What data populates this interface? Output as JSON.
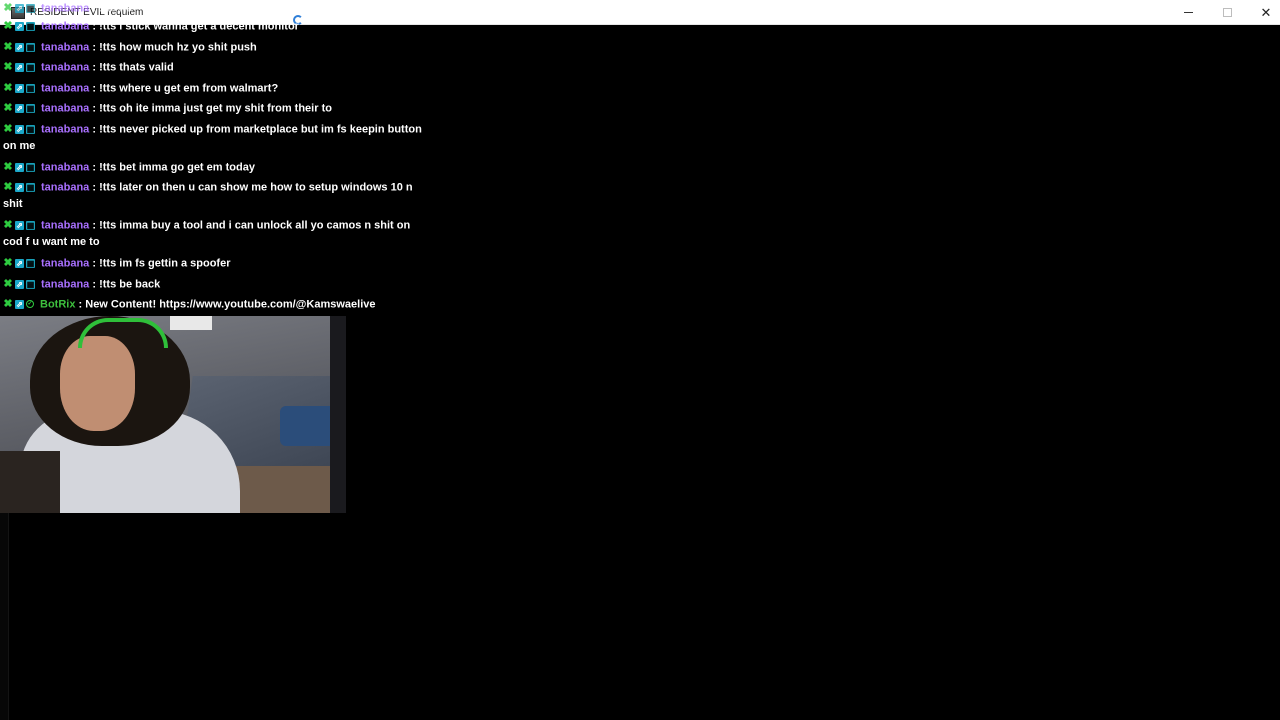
{
  "window": {
    "title": "RESIDENT EVIL requiem",
    "icon": "app-icon",
    "controls": {
      "minimize": "minimize-icon",
      "maximize": "maximize-icon",
      "close_glyph": "✕"
    }
  },
  "chat": {
    "colors": {
      "username": "#a970ff",
      "bot_username": "#3ec13e",
      "mod_badge": "#2ecc40",
      "vip_badge": "#1aa7c9"
    },
    "messages": [
      {
        "user": "tanabana",
        "sep": ":",
        "text": "!tts ite",
        "ghost": true
      },
      {
        "user": "tanabana",
        "sep": ":",
        "text": "!tts i stick wanna get a decent monitor"
      },
      {
        "user": "tanabana",
        "sep": ":",
        "text": "!tts how much hz yo shit push"
      },
      {
        "user": "tanabana",
        "sep": ":",
        "text": "!tts thats valid"
      },
      {
        "user": "tanabana",
        "sep": ":",
        "text": "!tts where u get em from walmart?"
      },
      {
        "user": "tanabana",
        "sep": ":",
        "text": "!tts oh ite imma just get my shit from their to"
      },
      {
        "user": "tanabana",
        "sep": ":",
        "text": "!tts never picked up from marketplace but im fs keepin button on me"
      },
      {
        "user": "tanabana",
        "sep": ":",
        "text": "!tts bet imma go get em today"
      },
      {
        "user": "tanabana",
        "sep": ":",
        "text": "!tts later on then u can show me how to setup windows 10 n shit"
      },
      {
        "user": "tanabana",
        "sep": ":",
        "text": "!tts imma buy a tool and i can unlock all yo camos n shit on cod f u want me to"
      },
      {
        "user": "tanabana",
        "sep": ":",
        "text": "!tts im fs gettin a spoofer"
      },
      {
        "user": "tanabana",
        "sep": ":",
        "text": "!tts be back"
      },
      {
        "user": "BotRix",
        "sep": ":",
        "text": "New Content! https://www.youtube.com/@Kamswaelive",
        "bot": true
      }
    ]
  },
  "webcam": {
    "icon": "webcam-feed"
  }
}
